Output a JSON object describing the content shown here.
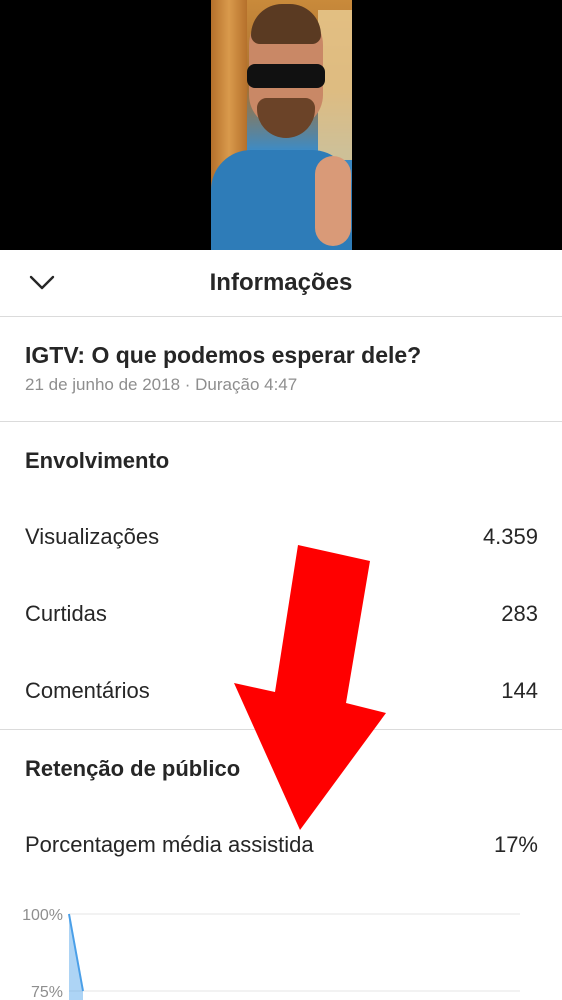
{
  "header": {
    "title": "Informações",
    "collapse_icon": "chevron-down-icon"
  },
  "video": {
    "title": "IGTV: O que podemos esperar dele?",
    "meta": "21 de junho de 2018 · Duração 4:47"
  },
  "engagement": {
    "section_title": "Envolvimento",
    "stats": [
      {
        "label": "Visualizações",
        "value": "4.359"
      },
      {
        "label": "Curtidas",
        "value": "283"
      },
      {
        "label": "Comentários",
        "value": "144"
      }
    ]
  },
  "retention": {
    "section_title": "Retenção de público",
    "average_label": "Porcentagem média assistida",
    "average_value": "17%"
  },
  "annotation": {
    "arrow_color": "#ff0000",
    "arrow_icon": "red-arrow-down-icon"
  },
  "chart_data": {
    "type": "area",
    "x": [
      0,
      1
    ],
    "y_ticks": [
      "100%",
      "75%"
    ],
    "ylim": [
      75,
      100
    ],
    "series": [
      {
        "values": [
          100,
          75
        ],
        "color": "#4a9fe8"
      }
    ],
    "grid": true
  }
}
